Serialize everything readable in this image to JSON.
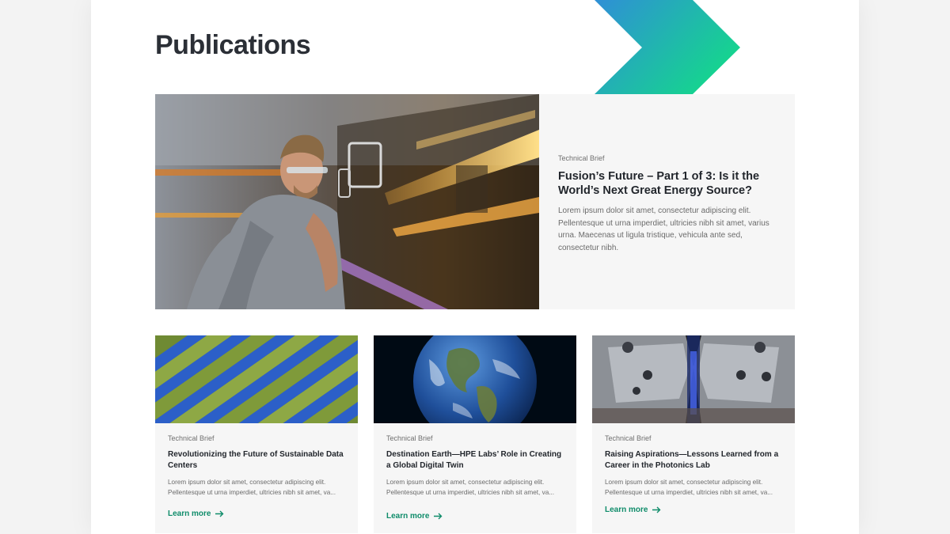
{
  "page": {
    "title": "Publications"
  },
  "colors": {
    "accent_green": "#0f8c6a",
    "chevron_start": "#2f8fd6",
    "chevron_end": "#15d68d"
  },
  "featured": {
    "eyebrow": "Technical Brief",
    "title": "Fusion’s Future – Part 1 of 3: Is it the World’s Next Great Energy Source?",
    "description": "Lorem ipsum dolor sit amet, consectetur adipiscing elit. Pellentesque ut urna imperdiet, ultricies nibh sit amet, varius urna. Maecenas ut ligula tristique, vehicula ante sed, consectetur nibh."
  },
  "cards": [
    {
      "eyebrow": "Technical Brief",
      "title": "Revolutionizing the Future of Sustainable Data Centers",
      "desc_line1": "Lorem ipsum dolor sit amet, consectetur adipiscing elit.",
      "desc_line2": "Pellentesque ut urna imperdiet, ultricies nibh sit amet, va...",
      "link": "Learn more"
    },
    {
      "eyebrow": "Technical Brief",
      "title": "Destination Earth—HPE Labs’ Role in Creating a Global Digital Twin",
      "desc_line1": "Lorem ipsum dolor sit amet, consectetur adipiscing elit.",
      "desc_line2": "Pellentesque ut urna imperdiet, ultricies nibh sit amet, va...",
      "link": "Learn more"
    },
    {
      "eyebrow": "Technical Brief",
      "title": "Raising Aspirations—Lessons Learned from a Career in the Photonics Lab",
      "desc_line1": "Lorem ipsum dolor sit amet, consectetur adipiscing elit.",
      "desc_line2": "Pellentesque ut urna imperdiet, ultricies nibh sit amet, va...",
      "link": "Learn more"
    }
  ],
  "icons": {
    "link_arrow": "arrow-right-icon",
    "decor": "chevron-decor-icon"
  }
}
